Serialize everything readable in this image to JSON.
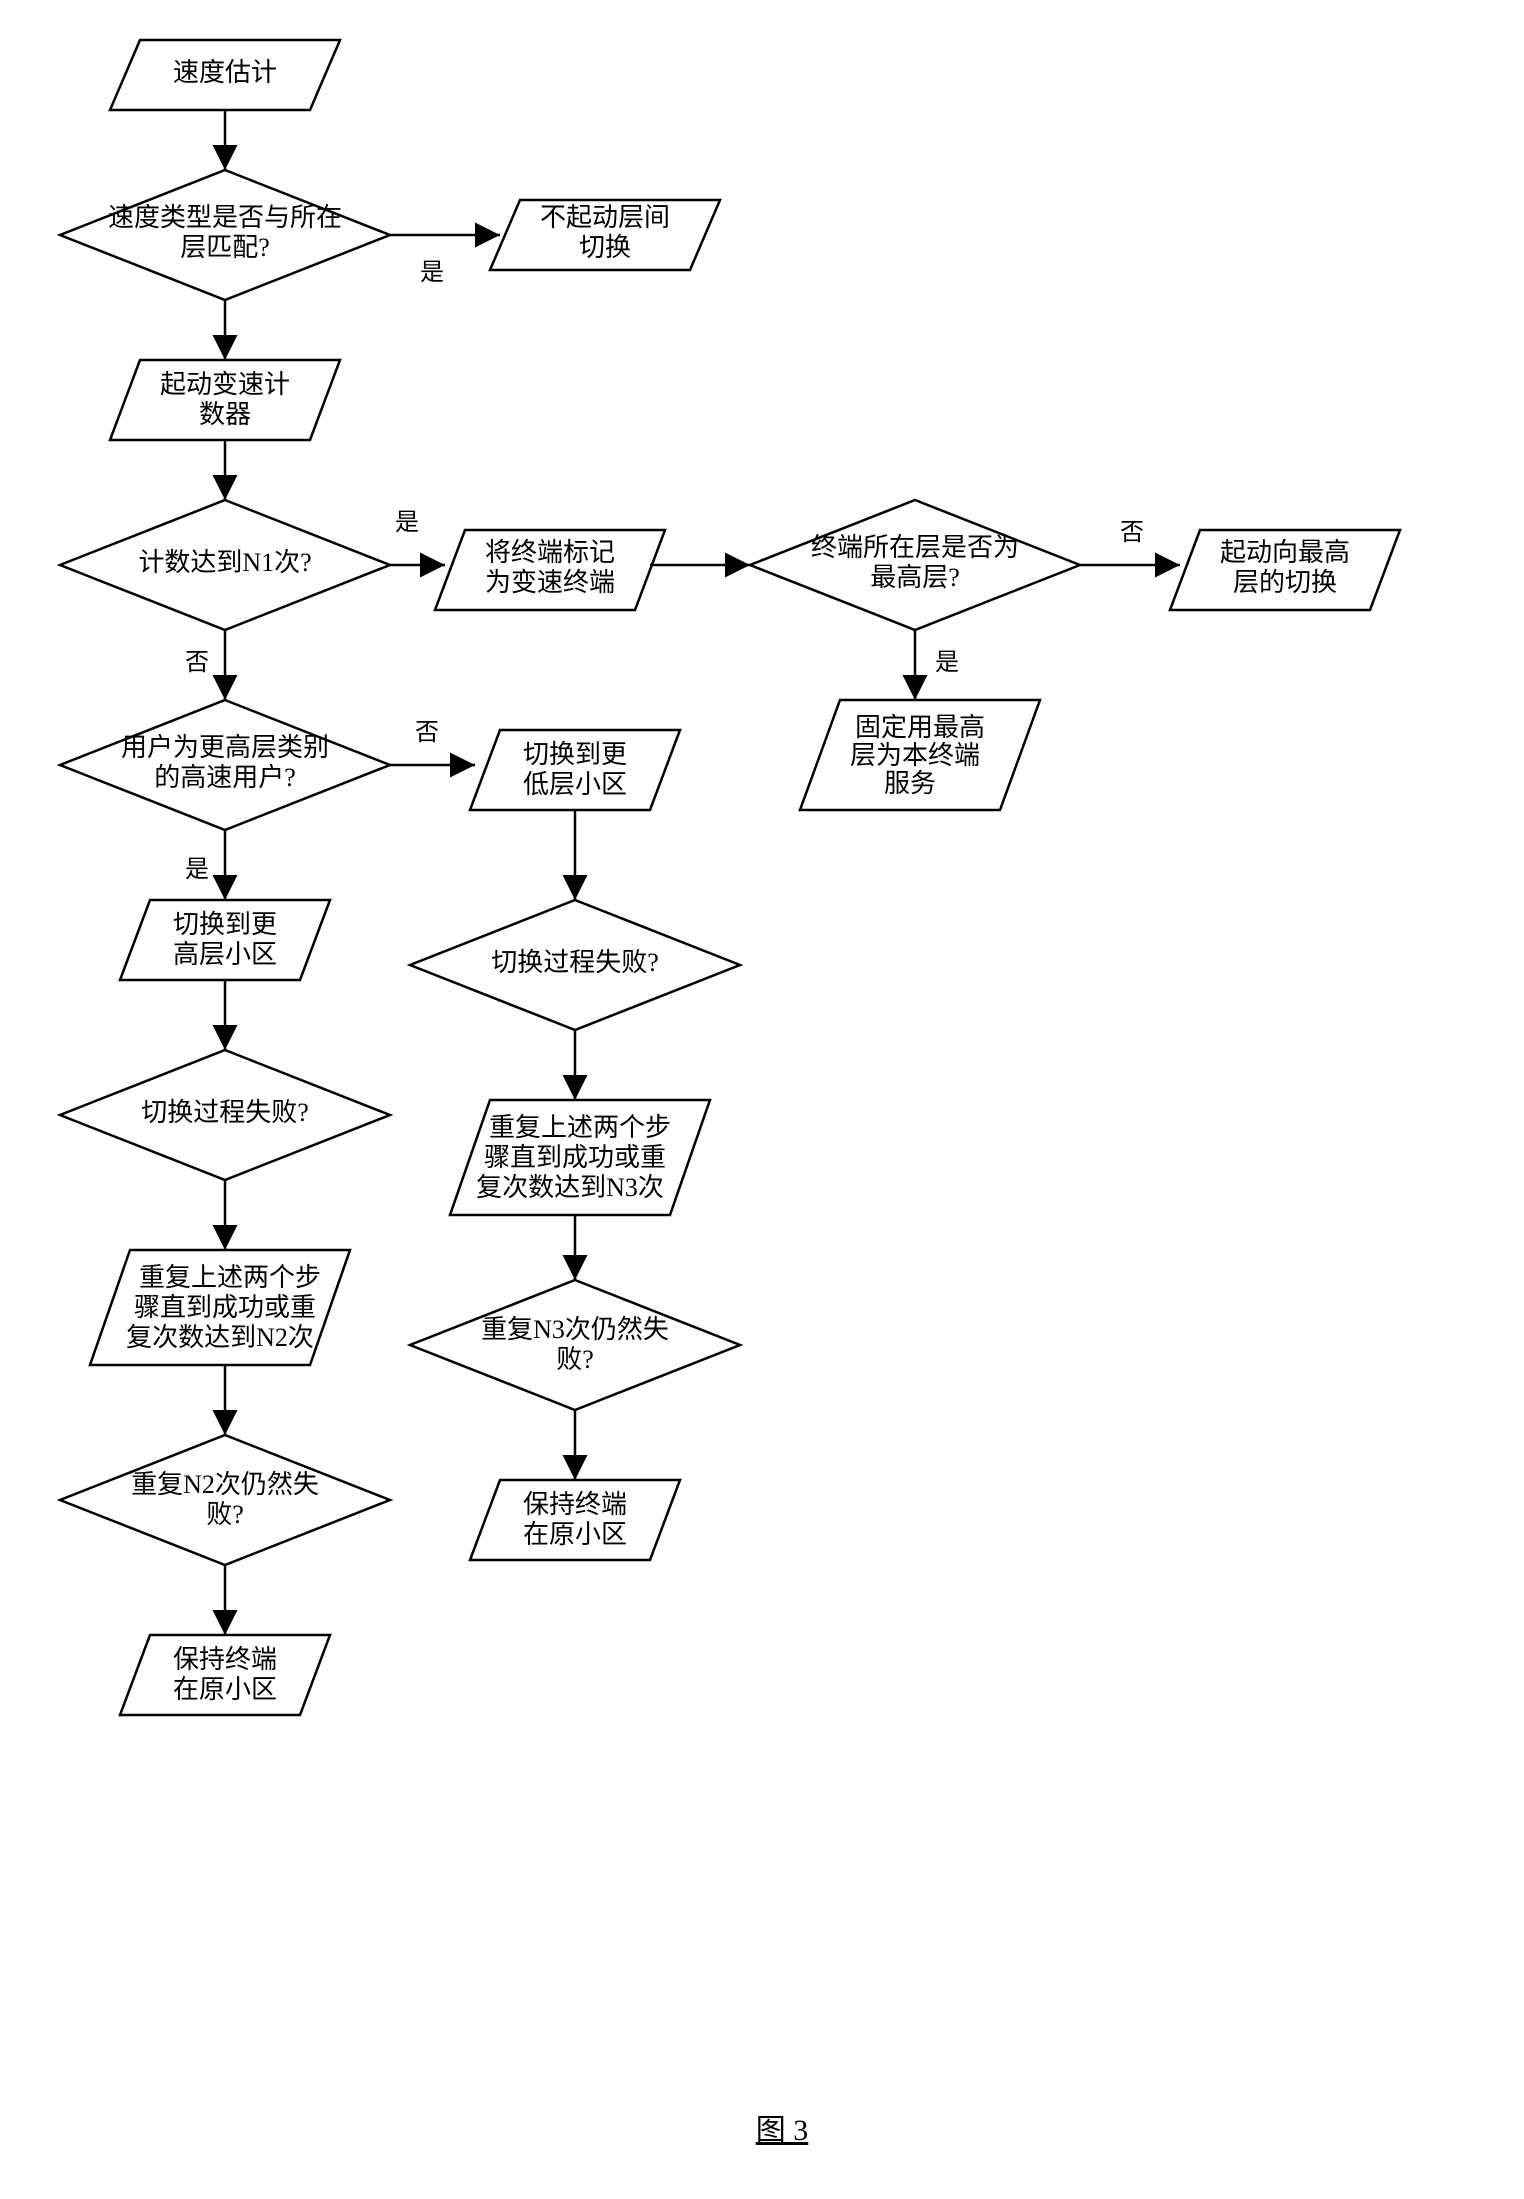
{
  "chart_data": {
    "type": "flowchart",
    "title": "图 3",
    "nodes": {
      "n1": {
        "label_lines": [
          "速度估计"
        ],
        "type": "parallelogram"
      },
      "n2": {
        "label_lines": [
          "速度类型是否与所在",
          "层匹配?"
        ],
        "type": "decision"
      },
      "n3": {
        "label_lines": [
          "不起动层间",
          "切换"
        ],
        "type": "parallelogram"
      },
      "n4": {
        "label_lines": [
          "起动变速计",
          "数器"
        ],
        "type": "parallelogram"
      },
      "n5": {
        "label_lines": [
          "计数达到N1次?"
        ],
        "type": "decision"
      },
      "n6": {
        "label_lines": [
          "将终端标记",
          "为变速终端"
        ],
        "type": "parallelogram"
      },
      "n7": {
        "label_lines": [
          "终端所在层是否为",
          "最高层?"
        ],
        "type": "decision"
      },
      "n8": {
        "label_lines": [
          "起动向最高",
          "层的切换"
        ],
        "type": "parallelogram"
      },
      "n9": {
        "label_lines": [
          "固定用最高",
          "层为本终端",
          "服务"
        ],
        "type": "parallelogram"
      },
      "n10": {
        "label_lines": [
          "用户为更高层类别",
          "的高速用户?"
        ],
        "type": "decision"
      },
      "n11": {
        "label_lines": [
          "切换到更",
          "低层小区"
        ],
        "type": "parallelogram"
      },
      "n12": {
        "label_lines": [
          "切换到更",
          "高层小区"
        ],
        "type": "parallelogram"
      },
      "n13": {
        "label_lines": [
          "切换过程失败?"
        ],
        "type": "decision"
      },
      "n14": {
        "label_lines": [
          "切换过程失败?"
        ],
        "type": "decision"
      },
      "n15": {
        "label_lines": [
          "重复上述两个步",
          "骤直到成功或重",
          "复次数达到N3次"
        ],
        "type": "parallelogram"
      },
      "n16": {
        "label_lines": [
          "重复上述两个步",
          "骤直到成功或重",
          "复次数达到N2次"
        ],
        "type": "parallelogram"
      },
      "n17": {
        "label_lines": [
          "重复N3次仍然失",
          "败?"
        ],
        "type": "decision"
      },
      "n18": {
        "label_lines": [
          "重复N2次仍然失",
          "败?"
        ],
        "type": "decision"
      },
      "n19": {
        "label_lines": [
          "保持终端",
          "在原小区"
        ],
        "type": "parallelogram"
      },
      "n20": {
        "label_lines": [
          "保持终端",
          "在原小区"
        ],
        "type": "parallelogram"
      }
    },
    "edges": [
      {
        "from": "n1",
        "to": "n2",
        "label": ""
      },
      {
        "from": "n2",
        "to": "n3",
        "label": "是"
      },
      {
        "from": "n2",
        "to": "n4",
        "label": ""
      },
      {
        "from": "n4",
        "to": "n5",
        "label": ""
      },
      {
        "from": "n5",
        "to": "n6",
        "label": "是"
      },
      {
        "from": "n6",
        "to": "n7",
        "label": ""
      },
      {
        "from": "n7",
        "to": "n8",
        "label": "否"
      },
      {
        "from": "n7",
        "to": "n9",
        "label": "是"
      },
      {
        "from": "n5",
        "to": "n10",
        "label": "否"
      },
      {
        "from": "n10",
        "to": "n11",
        "label": "否"
      },
      {
        "from": "n10",
        "to": "n12",
        "label": "是"
      },
      {
        "from": "n11",
        "to": "n13",
        "label": ""
      },
      {
        "from": "n12",
        "to": "n14",
        "label": ""
      },
      {
        "from": "n13",
        "to": "n15",
        "label": ""
      },
      {
        "from": "n14",
        "to": "n16",
        "label": ""
      },
      {
        "from": "n15",
        "to": "n17",
        "label": ""
      },
      {
        "from": "n16",
        "to": "n18",
        "label": ""
      },
      {
        "from": "n17",
        "to": "n19",
        "label": ""
      },
      {
        "from": "n18",
        "to": "n20",
        "label": ""
      }
    ],
    "labels": {
      "yes": "是",
      "no": "否"
    }
  }
}
